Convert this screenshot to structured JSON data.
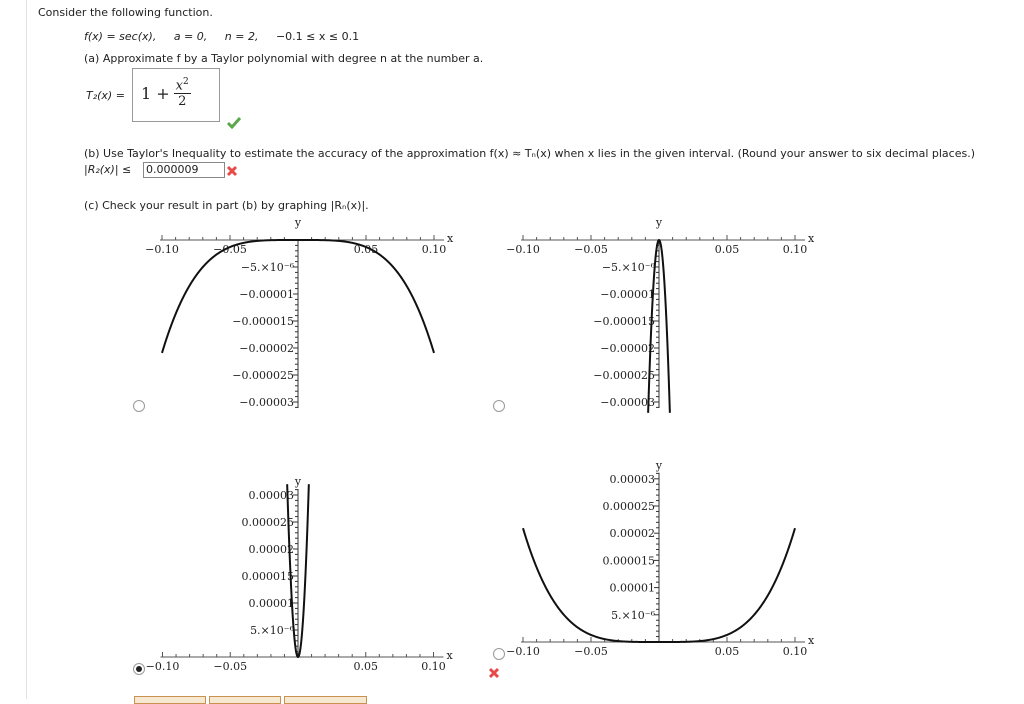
{
  "question": {
    "intro": "Consider the following function.",
    "function": "f(x) = sec(x),",
    "a": "a = 0,",
    "n": "n = 2,",
    "interval": "−0.1 ≤ x ≤ 0.1",
    "part_a": "(a) Approximate f by a Taylor polynomial with degree n at the number a.",
    "t2_label": "T₂(x) =",
    "t2_answer": {
      "lead": "1 +",
      "numerator": "x",
      "power": "2",
      "denominator": "2"
    },
    "t2_status": "correct",
    "part_b": "(b) Use Taylor's Inequality to estimate the accuracy of the approximation  f(x) ≈ Tₙ(x)  when x lies in the given interval. (Round your answer to six decimal places.)",
    "r2_label": "|R₂(x)| ≤",
    "r2_value": "0.000009",
    "r2_status": "incorrect",
    "part_c": "(c) Check your result in part (b) by graphing  |Rₙ(x)|.",
    "status_colors": {
      "correct": "#5aa84a",
      "incorrect": "#e84a4a"
    }
  },
  "chart_data": [
    {
      "type": "line",
      "option": 1,
      "selected": false,
      "function": "-(sec(x) - 1 - x^2/2)",
      "xlabel": "x",
      "ylabel": "y",
      "xlim": [
        -0.1,
        0.1
      ],
      "ylim": [
        -3e-05,
        0
      ],
      "x_ticks": [
        "-0.10",
        "-0.05",
        "0.05",
        "0.10"
      ],
      "y_ticks": [
        "-5.×10⁻⁶",
        "-0.00001",
        "-0.000015",
        "-0.00002",
        "-0.000025",
        "-0.00003"
      ],
      "y_tick_values": [
        -5e-06,
        -1e-05,
        -1.5e-05,
        -2e-05,
        -2.5e-05,
        -3e-05
      ],
      "x": [
        -0.1,
        -0.075,
        -0.05,
        -0.025,
        0,
        0.025,
        0.05,
        0.075,
        0.1
      ],
      "y": [
        -2.09e-05,
        -6.6e-06,
        -1.3e-06,
        -8e-08,
        0,
        -8e-08,
        -1.3e-06,
        -6.6e-06,
        -2.09e-05
      ]
    },
    {
      "type": "line",
      "option": 2,
      "selected": false,
      "function": "-x^2/2",
      "xlabel": "x",
      "ylabel": "y",
      "xlim": [
        -0.1,
        0.1
      ],
      "ylim": [
        -3e-05,
        0
      ],
      "x_ticks": [
        "-0.10",
        "-0.05",
        "0.05",
        "0.10"
      ],
      "y_ticks": [
        "-5.×10⁻⁶",
        "-0.00001",
        "-0.000015",
        "-0.00002",
        "-0.000025",
        "-0.00003"
      ],
      "y_tick_values": [
        -5e-06,
        -1e-05,
        -1.5e-05,
        -2e-05,
        -2.5e-05,
        -3e-05
      ],
      "x": [
        -0.008,
        -0.006,
        -0.004,
        -0.002,
        0,
        0.002,
        0.004,
        0.006,
        0.008
      ],
      "y": [
        -3.2e-05,
        -1.8e-05,
        -8e-06,
        -2e-06,
        0,
        -2e-06,
        -8e-06,
        -1.8e-05,
        -3.2e-05
      ]
    },
    {
      "type": "line",
      "option": 3,
      "selected": true,
      "status": "",
      "function": "x^2/2",
      "xlabel": "x",
      "ylabel": "y",
      "xlim": [
        -0.1,
        0.1
      ],
      "ylim": [
        0,
        3e-05
      ],
      "x_ticks": [
        "-0.10",
        "-0.05",
        "0.05",
        "0.10"
      ],
      "y_ticks": [
        "5.×10⁻⁶",
        "0.00001",
        "0.000015",
        "0.00002",
        "0.000025",
        "0.00003"
      ],
      "y_tick_values": [
        5e-06,
        1e-05,
        1.5e-05,
        2e-05,
        2.5e-05,
        3e-05
      ],
      "x": [
        -0.008,
        -0.006,
        -0.004,
        -0.002,
        0,
        0.002,
        0.004,
        0.006,
        0.008
      ],
      "y": [
        3.2e-05,
        1.8e-05,
        8e-06,
        2e-06,
        0,
        2e-06,
        8e-06,
        1.8e-05,
        3.2e-05
      ]
    },
    {
      "type": "line",
      "option": 4,
      "selected": false,
      "status": "incorrect",
      "function": "sec(x) - 1 - x^2/2",
      "xlabel": "x",
      "ylabel": "y",
      "xlim": [
        -0.1,
        0.1
      ],
      "ylim": [
        0,
        3e-05
      ],
      "x_ticks": [
        "-0.10",
        "-0.05",
        "0.05",
        "0.10"
      ],
      "y_ticks": [
        "5.×10⁻⁶",
        "0.00001",
        "0.000015",
        "0.00002",
        "0.000025",
        "0.00003"
      ],
      "y_tick_values": [
        5e-06,
        1e-05,
        1.5e-05,
        2e-05,
        2.5e-05,
        3e-05
      ],
      "x": [
        -0.1,
        -0.075,
        -0.05,
        -0.025,
        0,
        0.025,
        0.05,
        0.075,
        0.1
      ],
      "y": [
        2.09e-05,
        6.6e-06,
        1.3e-06,
        8e-08,
        0,
        8e-08,
        1.3e-06,
        6.6e-06,
        2.09e-05
      ]
    }
  ]
}
